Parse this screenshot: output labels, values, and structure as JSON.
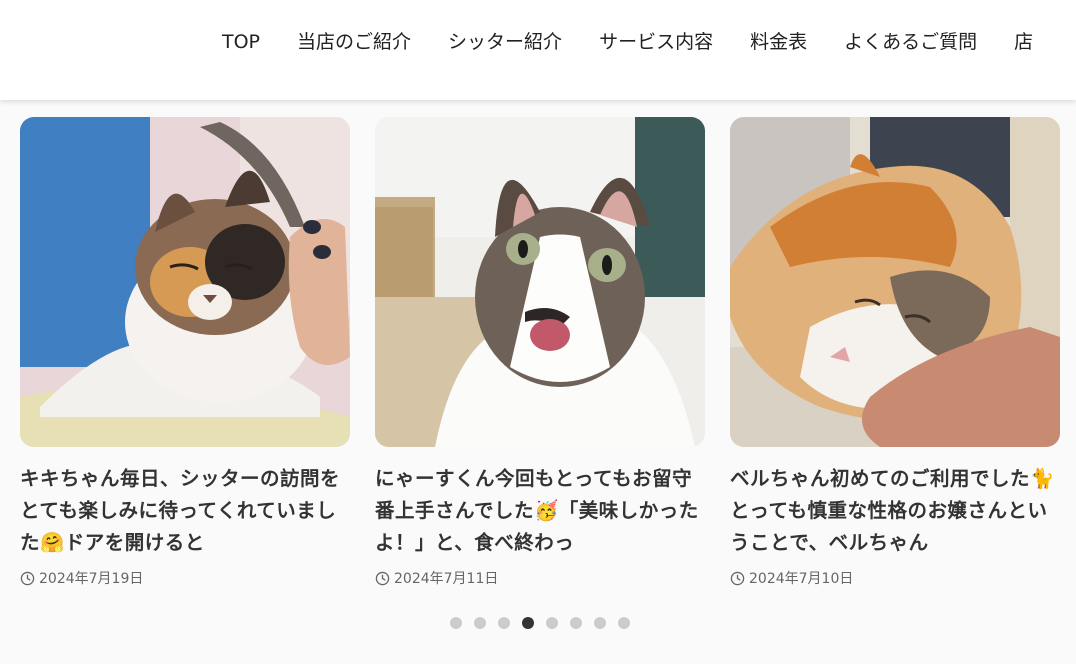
{
  "nav": {
    "items": [
      {
        "label": "TOP"
      },
      {
        "label": "当店のご紹介"
      },
      {
        "label": "シッター紹介"
      },
      {
        "label": "サービス内容"
      },
      {
        "label": "料金表"
      },
      {
        "label": "よくあるご質問"
      },
      {
        "label": "店"
      }
    ]
  },
  "posts": [
    {
      "title": "キキちゃん毎日、シッターの訪問をとても楽しみに待ってくれていました🤗ドアを開けると",
      "date": "2024年7月19日"
    },
    {
      "title": "にゃーすくん今回もとってもお留守番上手さんでした🥳「美味しかったよ！」と、食べ終わっ",
      "date": "2024年7月11日"
    },
    {
      "title": "ベルちゃん初めてのご利用でした🐈とっても慎重な性格のお嬢さんということで、ベルちゃん",
      "date": "2024年7月10日"
    }
  ],
  "carousel": {
    "total": 8,
    "active_index": 3
  },
  "icons": {
    "date": "clock-icon"
  },
  "colors": {
    "text": "#333333",
    "dot_active": "#333333",
    "dot_inactive": "#cccccc"
  }
}
